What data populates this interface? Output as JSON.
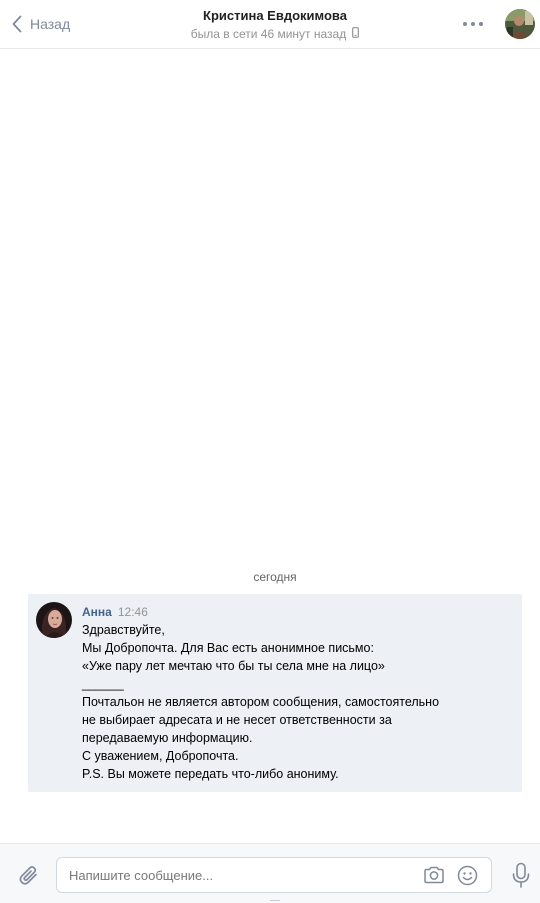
{
  "header": {
    "back_label": "Назад",
    "contact_name": "Кристина Евдокимова",
    "contact_status": "была в сети 46 минут назад"
  },
  "chat": {
    "date_separator": "сегодня",
    "messages": [
      {
        "author": "Анна",
        "time": "12:46",
        "lines": [
          "Здравствуйте,",
          "Мы Добропочта. Для Вас есть анонимное письмо:",
          "«Уже пару лет мечтаю что бы ты села мне на лицо»",
          "______",
          "Почтальон не является автором сообщения, самостоятельно",
          "не выбирает адресата и не несет ответственности за",
          "передаваемую информацию.",
          "С уважением, Добропочта.",
          "P.S. Вы можете передать что-либо анониму."
        ]
      }
    ]
  },
  "composer": {
    "placeholder": "Напишите сообщение..."
  },
  "icons": {
    "back": "chevron-left-icon",
    "more": "more-dots-icon",
    "phone": "mobile-phone-icon",
    "attach": "paperclip-icon",
    "camera": "camera-icon",
    "smile": "smile-icon",
    "mic": "microphone-icon"
  },
  "colors": {
    "accent_link": "#42648b",
    "icon_gray": "#828a99",
    "message_bg": "#edf0f5",
    "composer_bg": "#f7f8fa"
  }
}
